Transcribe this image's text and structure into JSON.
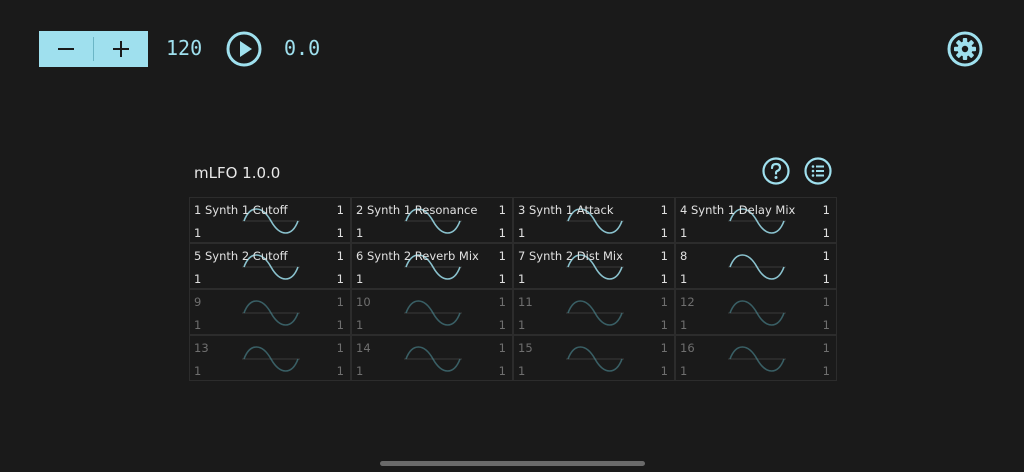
{
  "transport": {
    "decrement_icon": "minus-icon",
    "increment_icon": "plus-icon",
    "tempo": "120",
    "play_icon": "play-icon",
    "position": "0.0",
    "settings_icon": "gear-icon",
    "accent": "#9fe0ee"
  },
  "plugin": {
    "title": "mLFO 1.0.0",
    "help_icon": "question-icon",
    "menu_icon": "list-icon"
  },
  "lfos": [
    {
      "name": "1 Synth 1 Cutoff",
      "top_right": "1",
      "bottom_left": "1",
      "bottom_right": "1",
      "active": true
    },
    {
      "name": "2 Synth 1 Resonance",
      "top_right": "1",
      "bottom_left": "1",
      "bottom_right": "1",
      "active": true
    },
    {
      "name": "3 Synth 1 Attack",
      "top_right": "1",
      "bottom_left": "1",
      "bottom_right": "1",
      "active": true
    },
    {
      "name": "4 Synth 1 Delay Mix",
      "top_right": "1",
      "bottom_left": "1",
      "bottom_right": "1",
      "active": true
    },
    {
      "name": "5 Synth 2 Cutoff",
      "top_right": "1",
      "bottom_left": "1",
      "bottom_right": "1",
      "active": true
    },
    {
      "name": "6 Synth 2 Reverb Mix",
      "top_right": "1",
      "bottom_left": "1",
      "bottom_right": "1",
      "active": true
    },
    {
      "name": "7 Synth 2 Dist Mix",
      "top_right": "1",
      "bottom_left": "1",
      "bottom_right": "1",
      "active": true
    },
    {
      "name": "8",
      "top_right": "1",
      "bottom_left": "1",
      "bottom_right": "1",
      "active": true
    },
    {
      "name": "9",
      "top_right": "1",
      "bottom_left": "1",
      "bottom_right": "1",
      "active": false
    },
    {
      "name": "10",
      "top_right": "1",
      "bottom_left": "1",
      "bottom_right": "1",
      "active": false
    },
    {
      "name": "11",
      "top_right": "1",
      "bottom_left": "1",
      "bottom_right": "1",
      "active": false
    },
    {
      "name": "12",
      "top_right": "1",
      "bottom_left": "1",
      "bottom_right": "1",
      "active": false
    },
    {
      "name": "13",
      "top_right": "1",
      "bottom_left": "1",
      "bottom_right": "1",
      "active": false
    },
    {
      "name": "14",
      "top_right": "1",
      "bottom_left": "1",
      "bottom_right": "1",
      "active": false
    },
    {
      "name": "15",
      "top_right": "1",
      "bottom_left": "1",
      "bottom_right": "1",
      "active": false
    },
    {
      "name": "16",
      "top_right": "1",
      "bottom_left": "1",
      "bottom_right": "1",
      "active": false
    }
  ],
  "colors": {
    "background": "#1a1a1a",
    "wave_active": "#9fe0ee",
    "wave_inactive": "#4f8d97"
  }
}
